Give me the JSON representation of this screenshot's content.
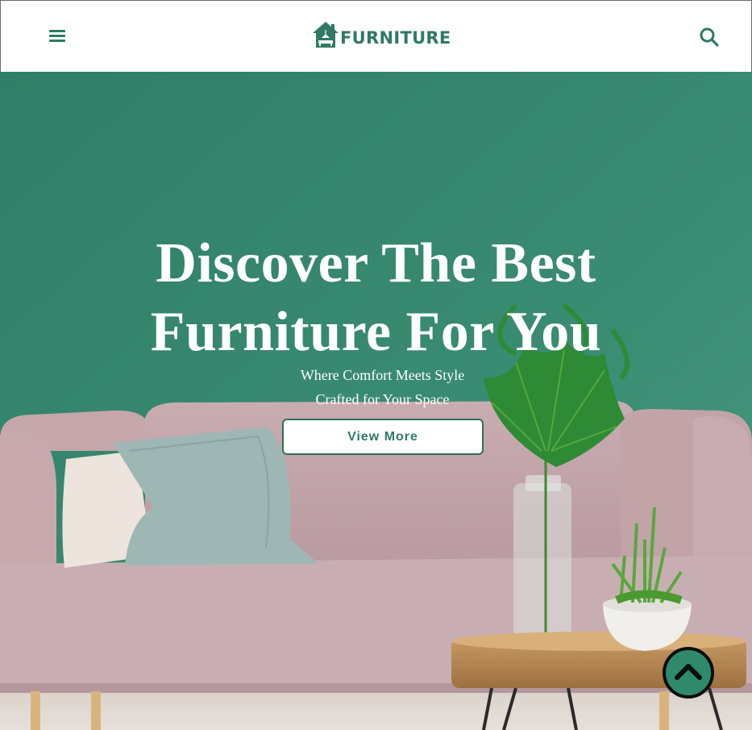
{
  "header": {
    "menu_icon": "hamburger-menu-icon",
    "logo_icon": "house-lamp-icon",
    "logo_text": "FURNITURE",
    "search_icon": "search-icon"
  },
  "hero": {
    "title_line1": "Discover The Best",
    "title_line2": "Furniture For You",
    "subtitle_line1": "Where Comfort Meets Style",
    "subtitle_line2": "Crafted for Your Space",
    "cta_label": "View More"
  },
  "scroll_top": {
    "icon": "chevron-up-icon"
  },
  "colors": {
    "brand_green": "#2f7a63",
    "wall_green": "#3a8c72",
    "sofa_pink": "#c8a9ad",
    "white": "#ffffff"
  }
}
